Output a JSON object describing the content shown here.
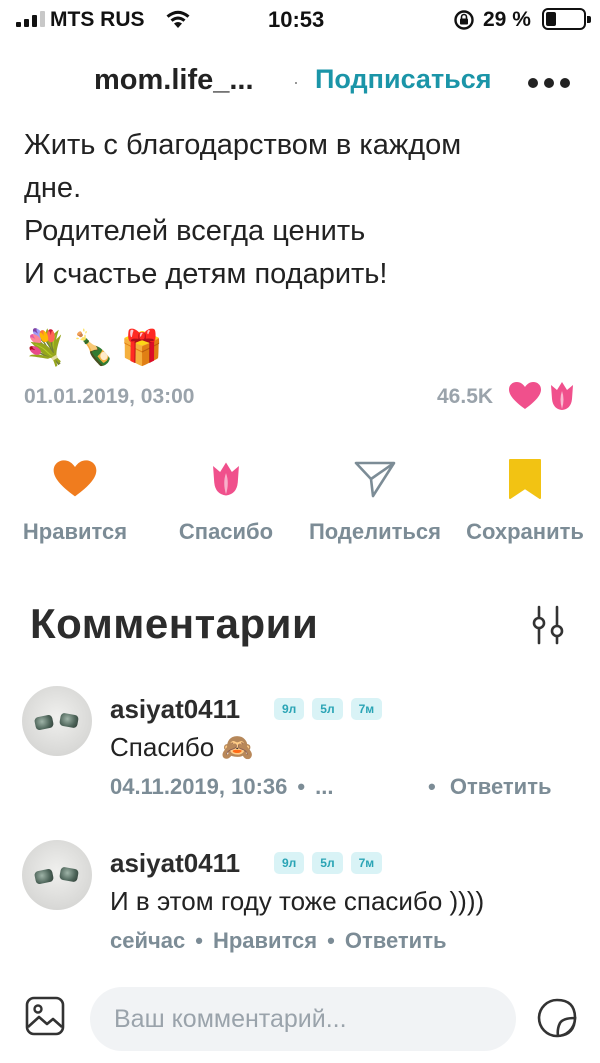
{
  "status_bar": {
    "carrier": "MTS RUS",
    "time": "10:53",
    "battery": "29 %"
  },
  "header": {
    "author": "mom.life_...",
    "separator": "·",
    "subscribe_label": "Подписаться"
  },
  "post": {
    "lines": [
      "Жить с благодарством в каждом",
      "дне.",
      "Родителей всегда ценить",
      "И счастье детям подарить!"
    ],
    "emojis": [
      "💐",
      "🍾",
      "🎁"
    ],
    "date": "01.01.2019, 03:00",
    "reaction_count": "46.5K"
  },
  "actions": {
    "like_label": "Нравится",
    "thanks_label": "Спасибо",
    "share_label": "Поделиться",
    "save_label": "Сохранить"
  },
  "comments": {
    "title": "Комментарии",
    "items": [
      {
        "username": "asiyat0411",
        "badges": [
          "9л",
          "5л",
          "7м"
        ],
        "text": "Спасибо 🙈",
        "date": "04.11.2019, 10:36",
        "sep": "•",
        "ellipsis": "...",
        "reply": "Ответить"
      },
      {
        "username": "asiyat0411",
        "badges": [
          "9л",
          "5л",
          "7м"
        ],
        "text": "И в этом году тоже спасибо ))))",
        "date": "сейчас",
        "sep": "•",
        "like": "Нравится",
        "reply": "Ответить"
      }
    ]
  },
  "input": {
    "placeholder": "Ваш комментарий..."
  },
  "colors": {
    "accent": "#1b95a8",
    "like": "#f07c1e",
    "thanks": "#f0508c",
    "save": "#f2c313",
    "muted": "#7c8c96"
  }
}
